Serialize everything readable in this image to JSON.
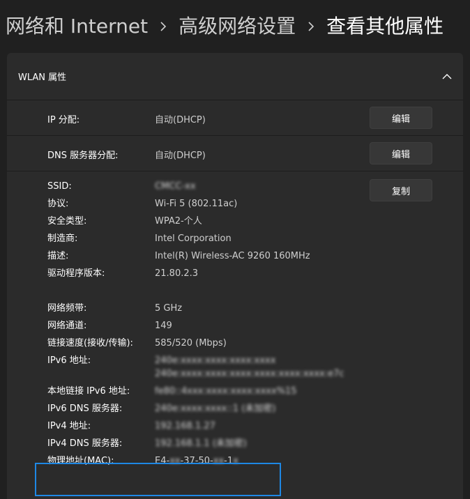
{
  "breadcrumb": {
    "item1": "网络和 Internet",
    "item2": "高级网络设置",
    "current": "查看其他属性"
  },
  "panel": {
    "title": "WLAN 属性"
  },
  "ip_assignment": {
    "label": "IP 分配:",
    "value": "自动(DHCP)",
    "button": "编辑"
  },
  "dns_assignment": {
    "label": "DNS 服务器分配:",
    "value": "自动(DHCP)",
    "button": "编辑"
  },
  "copy_button": "复制",
  "properties": [
    {
      "label": "SSID:",
      "value": "CMCC-xx"
    },
    {
      "label": "协议:",
      "value": "Wi-Fi 5 (802.11ac)"
    },
    {
      "label": "安全类型:",
      "value": "WPA2-个人"
    },
    {
      "label": "制造商:",
      "value": "Intel Corporation"
    },
    {
      "label": "描述:",
      "value": "Intel(R) Wireless-AC 9260 160MHz"
    },
    {
      "label": "驱动程序版本:",
      "value": "21.80.2.3"
    },
    {
      "label": "网络频带:",
      "value": "5 GHz"
    },
    {
      "label": "网络通道:",
      "value": "149"
    },
    {
      "label": "链接速度(接收/传输):",
      "value": "585/520 (Mbps)"
    },
    {
      "label": "IPv6 地址:",
      "value": "240e:xxxx:xxxx:xxxx:xxxx",
      "value2": "240e:xxxx:xxxx:xxxx:xxxx:xxxx:xxxx:e7c"
    },
    {
      "label": "本地链接 IPv6 地址:",
      "value": "fe80::4xxx:xxxx:xxxx:xxxx%15"
    },
    {
      "label": "IPv6 DNS 服务器:",
      "value": "240e:xxxx:xxxx::1 (未加密)"
    },
    {
      "label": "IPv4 地址:",
      "value": "192.168.1.27"
    },
    {
      "label": "IPv4 DNS 服务器:",
      "value": "192.168.1.1 (未加密)"
    },
    {
      "label": "物理地址(MAC):",
      "value": "E4-",
      "value_blur1": "xx",
      "value_mid": "-37-50-",
      "value_blur2": "xx",
      "value_end": "-1",
      "value_blur3": "x"
    }
  ],
  "colors": {
    "background": "#202020",
    "panel": "#2b2b2b",
    "highlight": "#1e88e5"
  }
}
